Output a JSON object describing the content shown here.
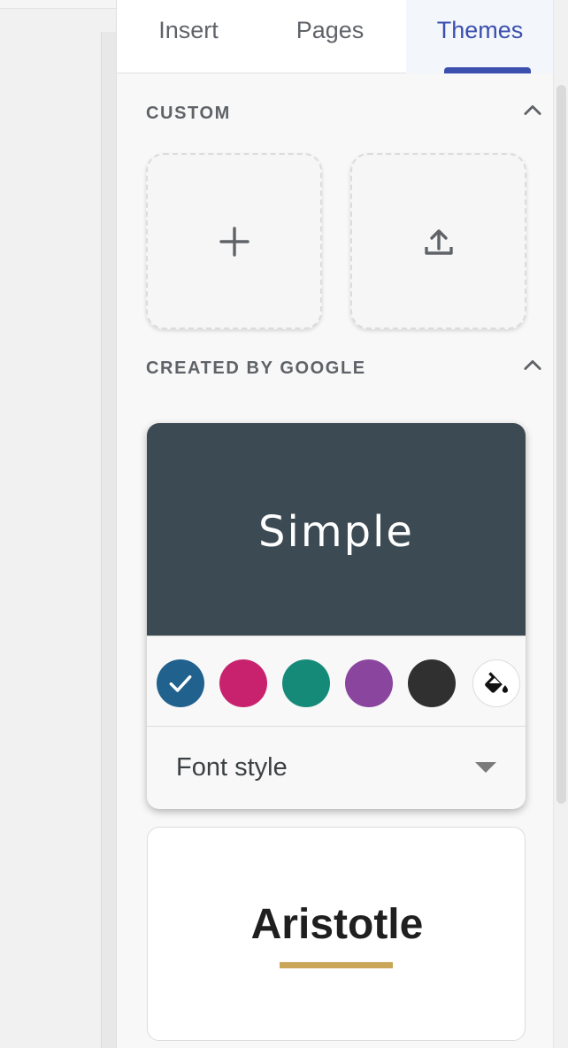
{
  "tabs": [
    {
      "label": "Insert",
      "active": false
    },
    {
      "label": "Pages",
      "active": false
    },
    {
      "label": "Themes",
      "active": true
    }
  ],
  "custom_section": {
    "title": "CUSTOM",
    "tiles": [
      {
        "icon": "plus-icon"
      },
      {
        "icon": "upload-icon"
      }
    ]
  },
  "google_section": {
    "title": "CREATED BY GOOGLE",
    "themes": [
      {
        "name": "Simple",
        "preview_color": "#3b4a53",
        "selected_color_index": 0,
        "colors": [
          "#20618e",
          "#c8226e",
          "#168a78",
          "#8a459e",
          "#303030"
        ],
        "font_style_label": "Font style"
      },
      {
        "name": "Aristotle",
        "accent_color": "#c9a658"
      }
    ]
  },
  "accent_color": "#3b4fae"
}
